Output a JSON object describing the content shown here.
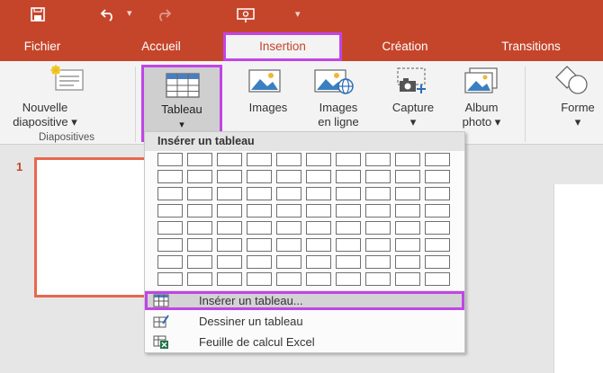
{
  "quick_access": {
    "save_icon": "save-icon",
    "undo_icon": "undo-icon",
    "redo_icon": "redo-icon",
    "presentation_icon": "start-presentation-icon"
  },
  "tabs": [
    {
      "label": "Fichier"
    },
    {
      "label": "Accueil"
    },
    {
      "label": "Insertion"
    },
    {
      "label": "Création"
    },
    {
      "label": "Transitions"
    }
  ],
  "ribbon": {
    "new_slide_line1": "Nouvelle",
    "new_slide_line2": "diapositive ▾",
    "group_label": "Diapositives",
    "tableau_label": "Tableau",
    "tableau_arrow": "▾",
    "images_label": "Images",
    "online_images_line1": "Images",
    "online_images_line2": "en ligne",
    "capture_label": "Capture",
    "capture_arrow": "▾",
    "album_line1": "Album",
    "album_line2": "photo ▾",
    "formes_label": "Forme",
    "formes_arrow": "▾"
  },
  "slides_panel": {
    "slide_number": "1"
  },
  "dropdown": {
    "title": "Insérer un tableau",
    "grid_cols": 10,
    "grid_rows": 8,
    "items": [
      {
        "label": "Insérer un tableau...",
        "icon": "insert-table-icon"
      },
      {
        "label": "Dessiner un tableau",
        "icon": "draw-table-icon"
      },
      {
        "label": "Feuille de calcul Excel",
        "icon": "excel-sheet-icon"
      }
    ]
  },
  "colors": {
    "accent": "#c5452b",
    "highlight": "#c045e6"
  }
}
